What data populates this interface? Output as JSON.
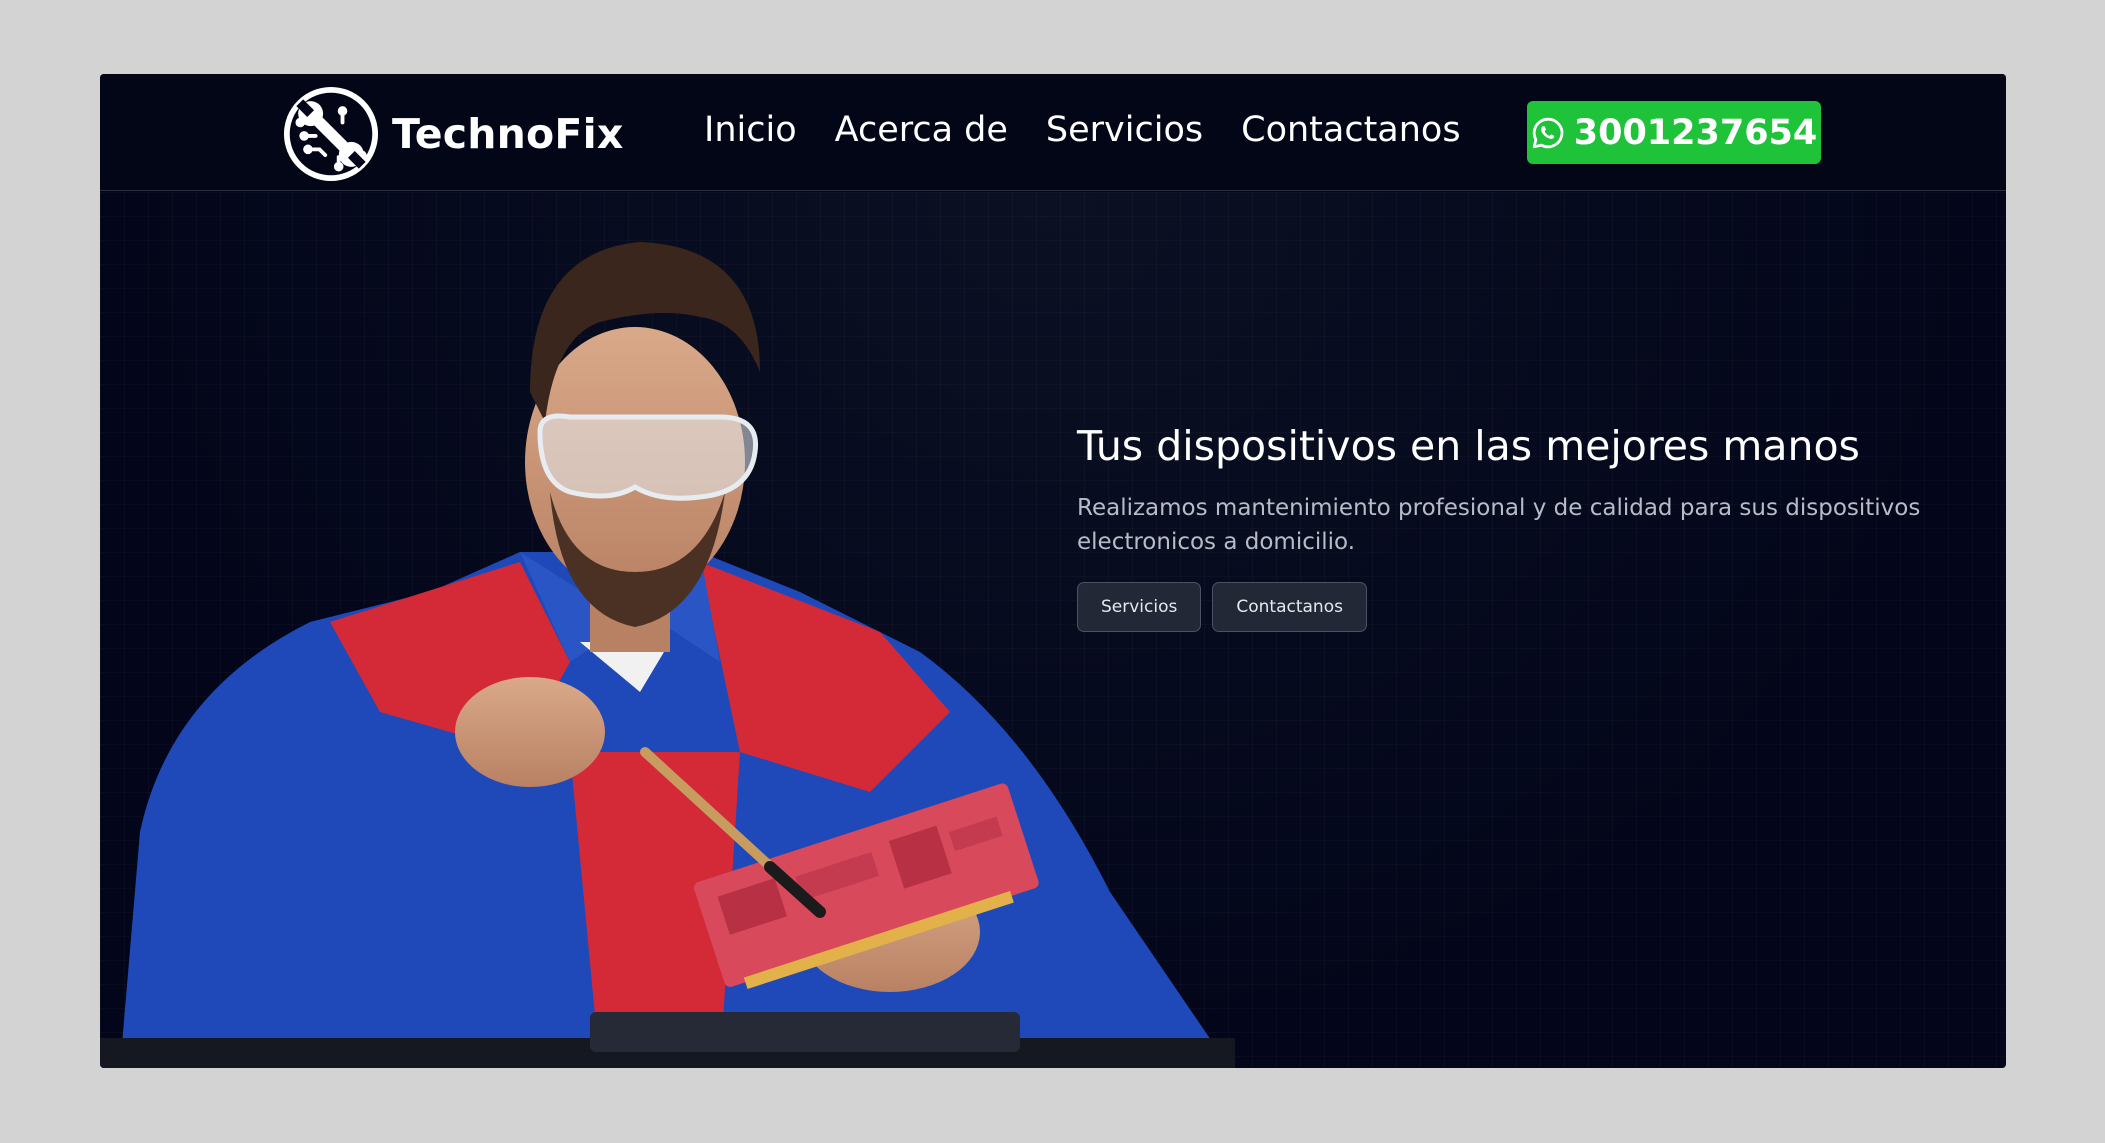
{
  "navbar": {
    "brand_name": "TechnoFix",
    "logo_icon": "wrench-circuit-logo-icon",
    "links": [
      {
        "label": "Inicio"
      },
      {
        "label": "Acerca de"
      },
      {
        "label": "Servicios"
      },
      {
        "label": "Contactanos"
      }
    ],
    "whatsapp": {
      "icon": "whatsapp-icon",
      "number": "3001237654",
      "color": "#1fc33a"
    }
  },
  "hero": {
    "image": "technician-repairing-circuit-board",
    "title": "Tus dispositivos en las mejores manos",
    "text": "Realizamos mantenimiento profesional y de calidad para sus dispositivos electronicos a domicilio.",
    "buttons": [
      {
        "label": "Servicios"
      },
      {
        "label": "Contactanos"
      }
    ]
  },
  "colors": {
    "background": "#03061a",
    "accent": "#1fc33a"
  }
}
